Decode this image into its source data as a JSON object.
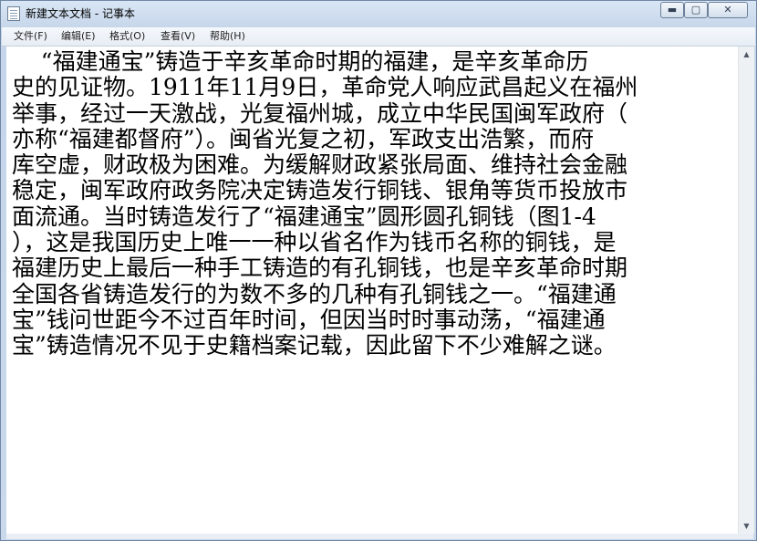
{
  "window": {
    "title": "新建文本文档 - 记事本",
    "controls": {
      "minimize": "▬",
      "maximize": "▢",
      "close": "✕"
    }
  },
  "menu": {
    "file": "文件(F)",
    "edit": "编辑(E)",
    "format": "格式(O)",
    "view": "查看(V)",
    "help": "帮助(H)"
  },
  "document": {
    "lines": [
      "    “福建通宝”铸造于辛亥革命时期的福建，是辛亥革命历",
      "史的见证物。1911年11月9日，革命党人响应武昌起义在福州",
      "举事，经过一天激战，光复福州城，成立中华民国闽军政府（",
      "亦称“福建都督府”）。闽省光复之初，军政支出浩繁，而府",
      "库空虚，财政极为困难。为缓解财政紧张局面、维持社会金融",
      "稳定，闽军政府政务院决定铸造发行铜钱、银角等货币投放市",
      "面流通。当时铸造发行了“福建通宝”圆形圆孔铜钱（图1-4",
      "），这是我国历史上唯一一种以省名作为钱币名称的铜钱，是",
      "福建历史上最后一种手工铸造的有孔铜钱，也是辛亥革命时期",
      "全国各省铸造发行的为数不多的几种有孔铜钱之一。“福建通",
      "宝”钱问世距今不过百年时间，但因当时时事动荡，“福建通",
      "宝”铸造情况不见于史籍档案记载，因此留下不少难解之谜。"
    ]
  },
  "scrollbar": {
    "up": "▲",
    "down": "▼"
  }
}
